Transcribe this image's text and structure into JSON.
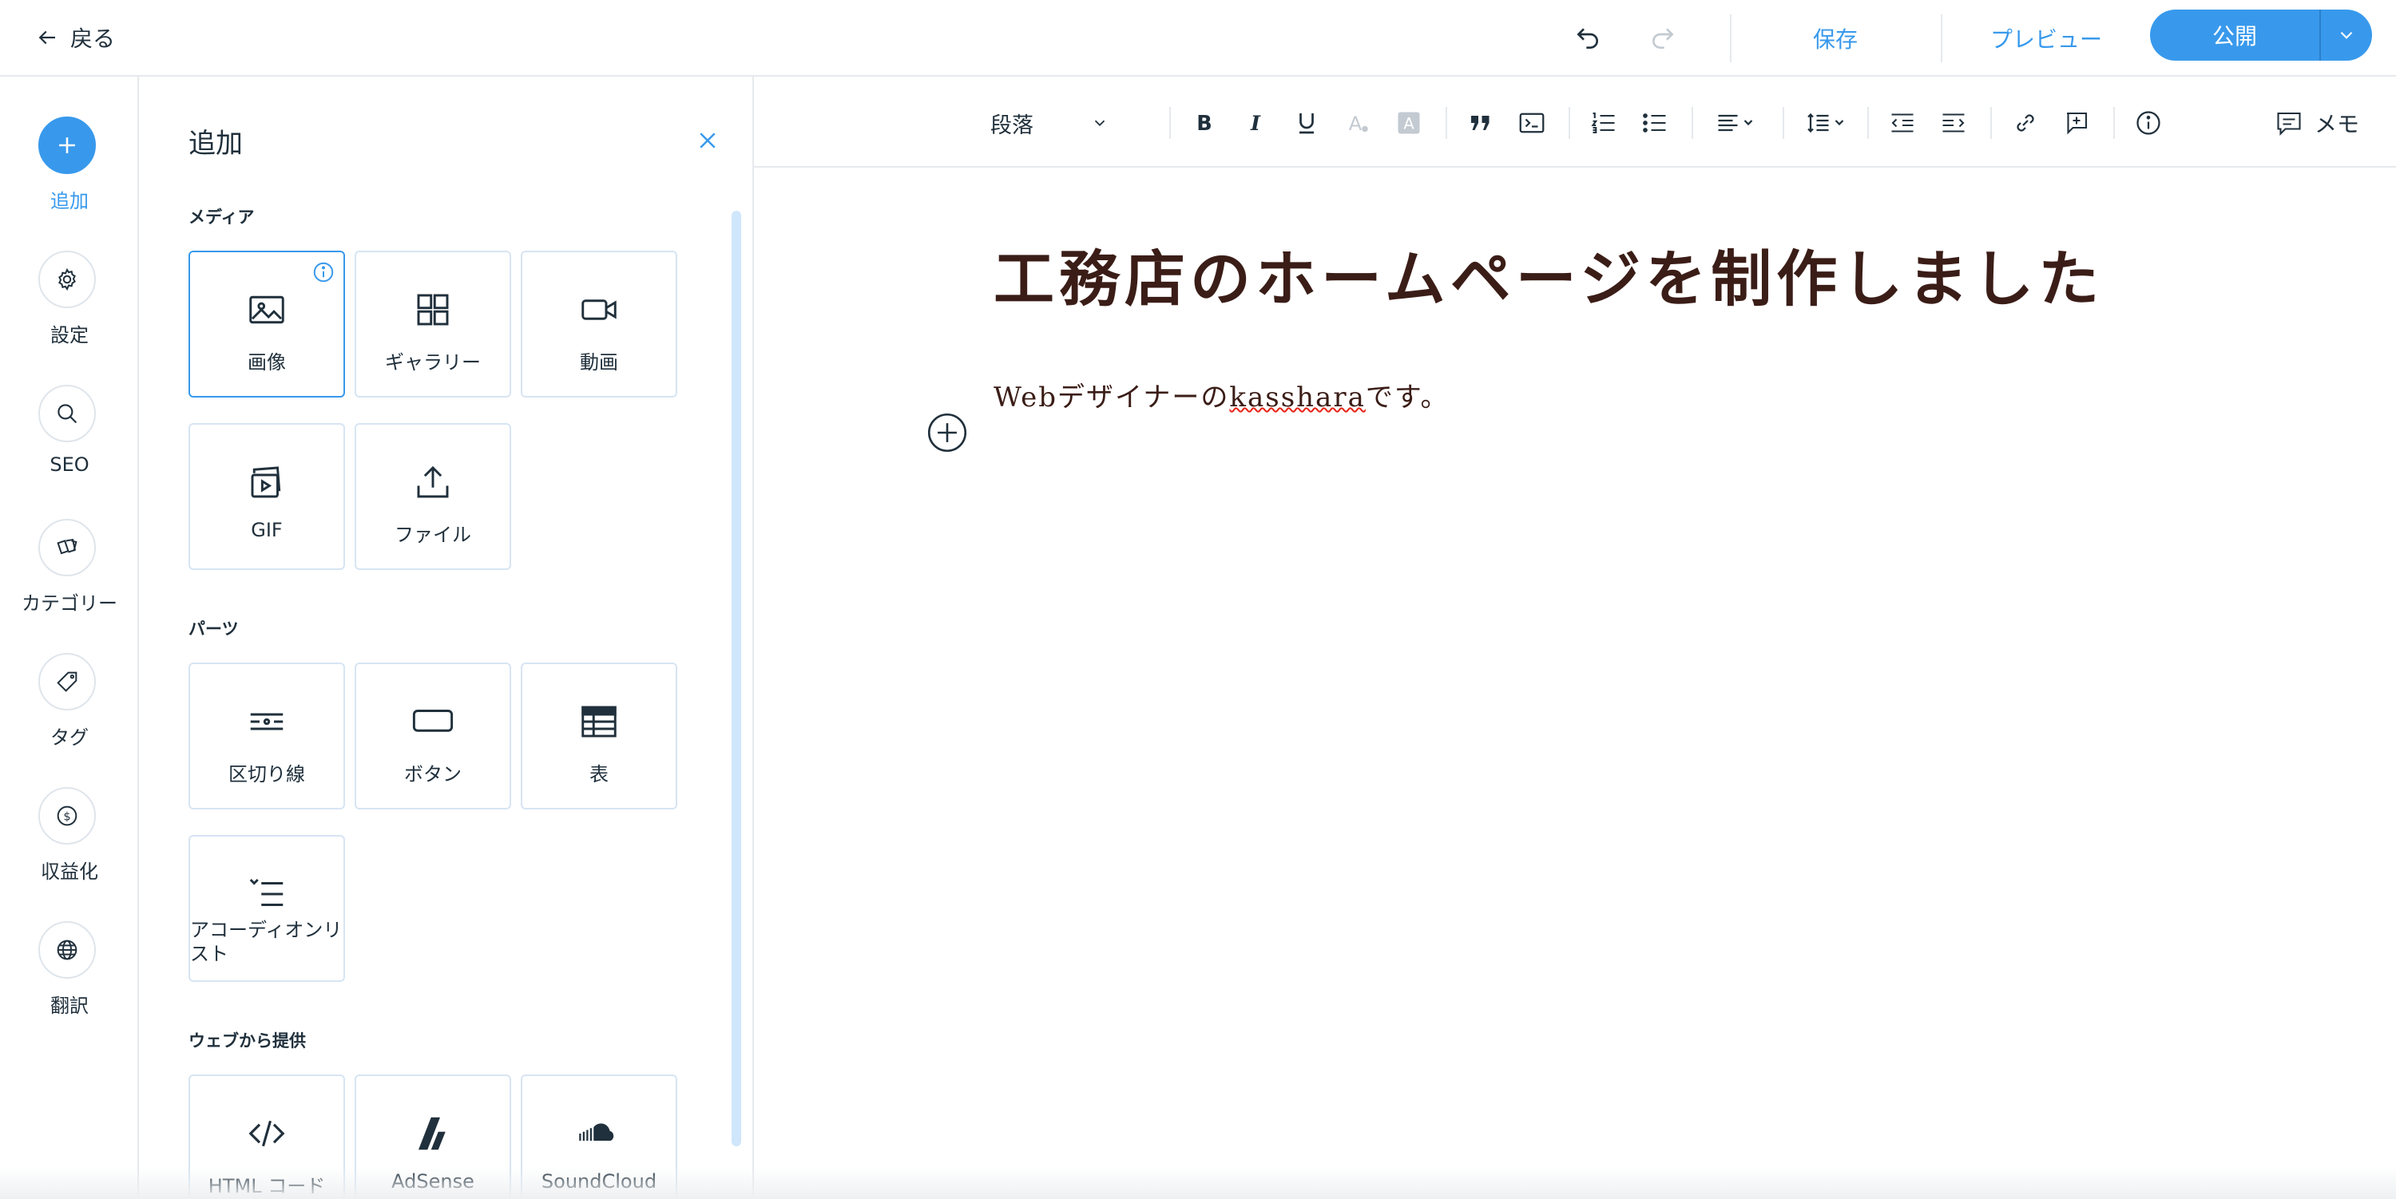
{
  "topbar": {
    "back_label": "戻る",
    "save_label": "保存",
    "preview_label": "プレビュー",
    "publish_label": "公開",
    "accent_color": "#3899ec"
  },
  "rail": {
    "items": [
      {
        "label": "追加",
        "icon": "plus-icon",
        "active": true
      },
      {
        "label": "設定",
        "icon": "gear-icon",
        "active": false
      },
      {
        "label": "SEO",
        "icon": "search-icon",
        "active": false
      },
      {
        "label": "カテゴリー",
        "icon": "cards-icon",
        "active": false
      },
      {
        "label": "タグ",
        "icon": "tag-icon",
        "active": false
      },
      {
        "label": "収益化",
        "icon": "dollar-icon",
        "active": false
      },
      {
        "label": "翻訳",
        "icon": "globe-icon",
        "active": false
      }
    ]
  },
  "panel": {
    "title": "追加",
    "sections": {
      "media": {
        "title": "メディア",
        "items": [
          "画像",
          "ギャラリー",
          "動画",
          "GIF",
          "ファイル"
        ]
      },
      "parts": {
        "title": "パーツ",
        "items": [
          "区切り線",
          "ボタン",
          "表",
          "アコーディオンリスト"
        ]
      },
      "web": {
        "title": "ウェブから提供",
        "items": [
          "HTML コード",
          "AdSense",
          "SoundCloud"
        ]
      }
    }
  },
  "toolbar": {
    "paragraph_style": "段落",
    "memo_label": "メモ"
  },
  "post": {
    "title": "工務店のホームページを制作しました",
    "body_before": "Webデザイナーの",
    "body_misspelled": "kasshara",
    "body_after": "です。"
  }
}
